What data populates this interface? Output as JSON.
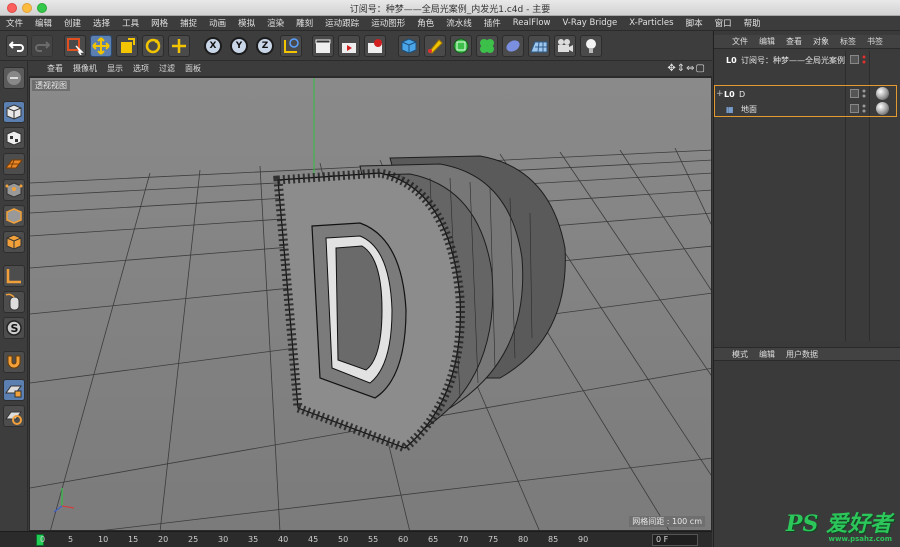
{
  "window": {
    "title": "订阅号：种梦——全局光案例_内发光1.c4d - 主要"
  },
  "menubar": [
    "文件",
    "编辑",
    "创建",
    "选择",
    "工具",
    "网格",
    "捕捉",
    "动画",
    "模拟",
    "渲染",
    "雕刻",
    "运动跟踪",
    "运动图形",
    "角色",
    "流水线",
    "插件",
    "RealFlow",
    "V-Ray Bridge",
    "X-Particles",
    "脚本",
    "窗口",
    "帮助"
  ],
  "toolbar": {
    "axis_x": "X",
    "axis_y": "Y",
    "axis_z": "Z"
  },
  "viewport": {
    "menu": [
      "查看",
      "摄像机",
      "显示",
      "选项",
      "过滤",
      "面板"
    ],
    "nav_icons": "✥⇕⇔▢",
    "label": "透视视图",
    "grid_info": "网格间距 : 100 cm"
  },
  "timeline": {
    "marks": [
      "0",
      "5",
      "10",
      "15",
      "20",
      "25",
      "30",
      "35",
      "40",
      "45",
      "50",
      "55",
      "60",
      "65",
      "70",
      "75",
      "80",
      "85",
      "90"
    ],
    "frame_value": "0 F"
  },
  "object_manager": {
    "tabs": [
      "文件",
      "编辑",
      "查看",
      "对象",
      "标签",
      "书签"
    ],
    "objects": [
      {
        "prefix": "L0",
        "name": "订阅号：种梦——全局光案例"
      },
      {
        "prefix": "L0",
        "name": "D"
      },
      {
        "prefix": "▦",
        "name": "地面"
      }
    ]
  },
  "attribute_manager": {
    "tabs": [
      "模式",
      "编辑",
      "用户数据"
    ]
  },
  "watermark": {
    "main": "PS 爱好者",
    "sub": "www.psahz.com"
  },
  "colors": {
    "accent_blue": "#5b7fb0",
    "selection_orange": "#e39a2e",
    "timeline_green": "#22cc55",
    "y_axis_green": "#33c040"
  }
}
